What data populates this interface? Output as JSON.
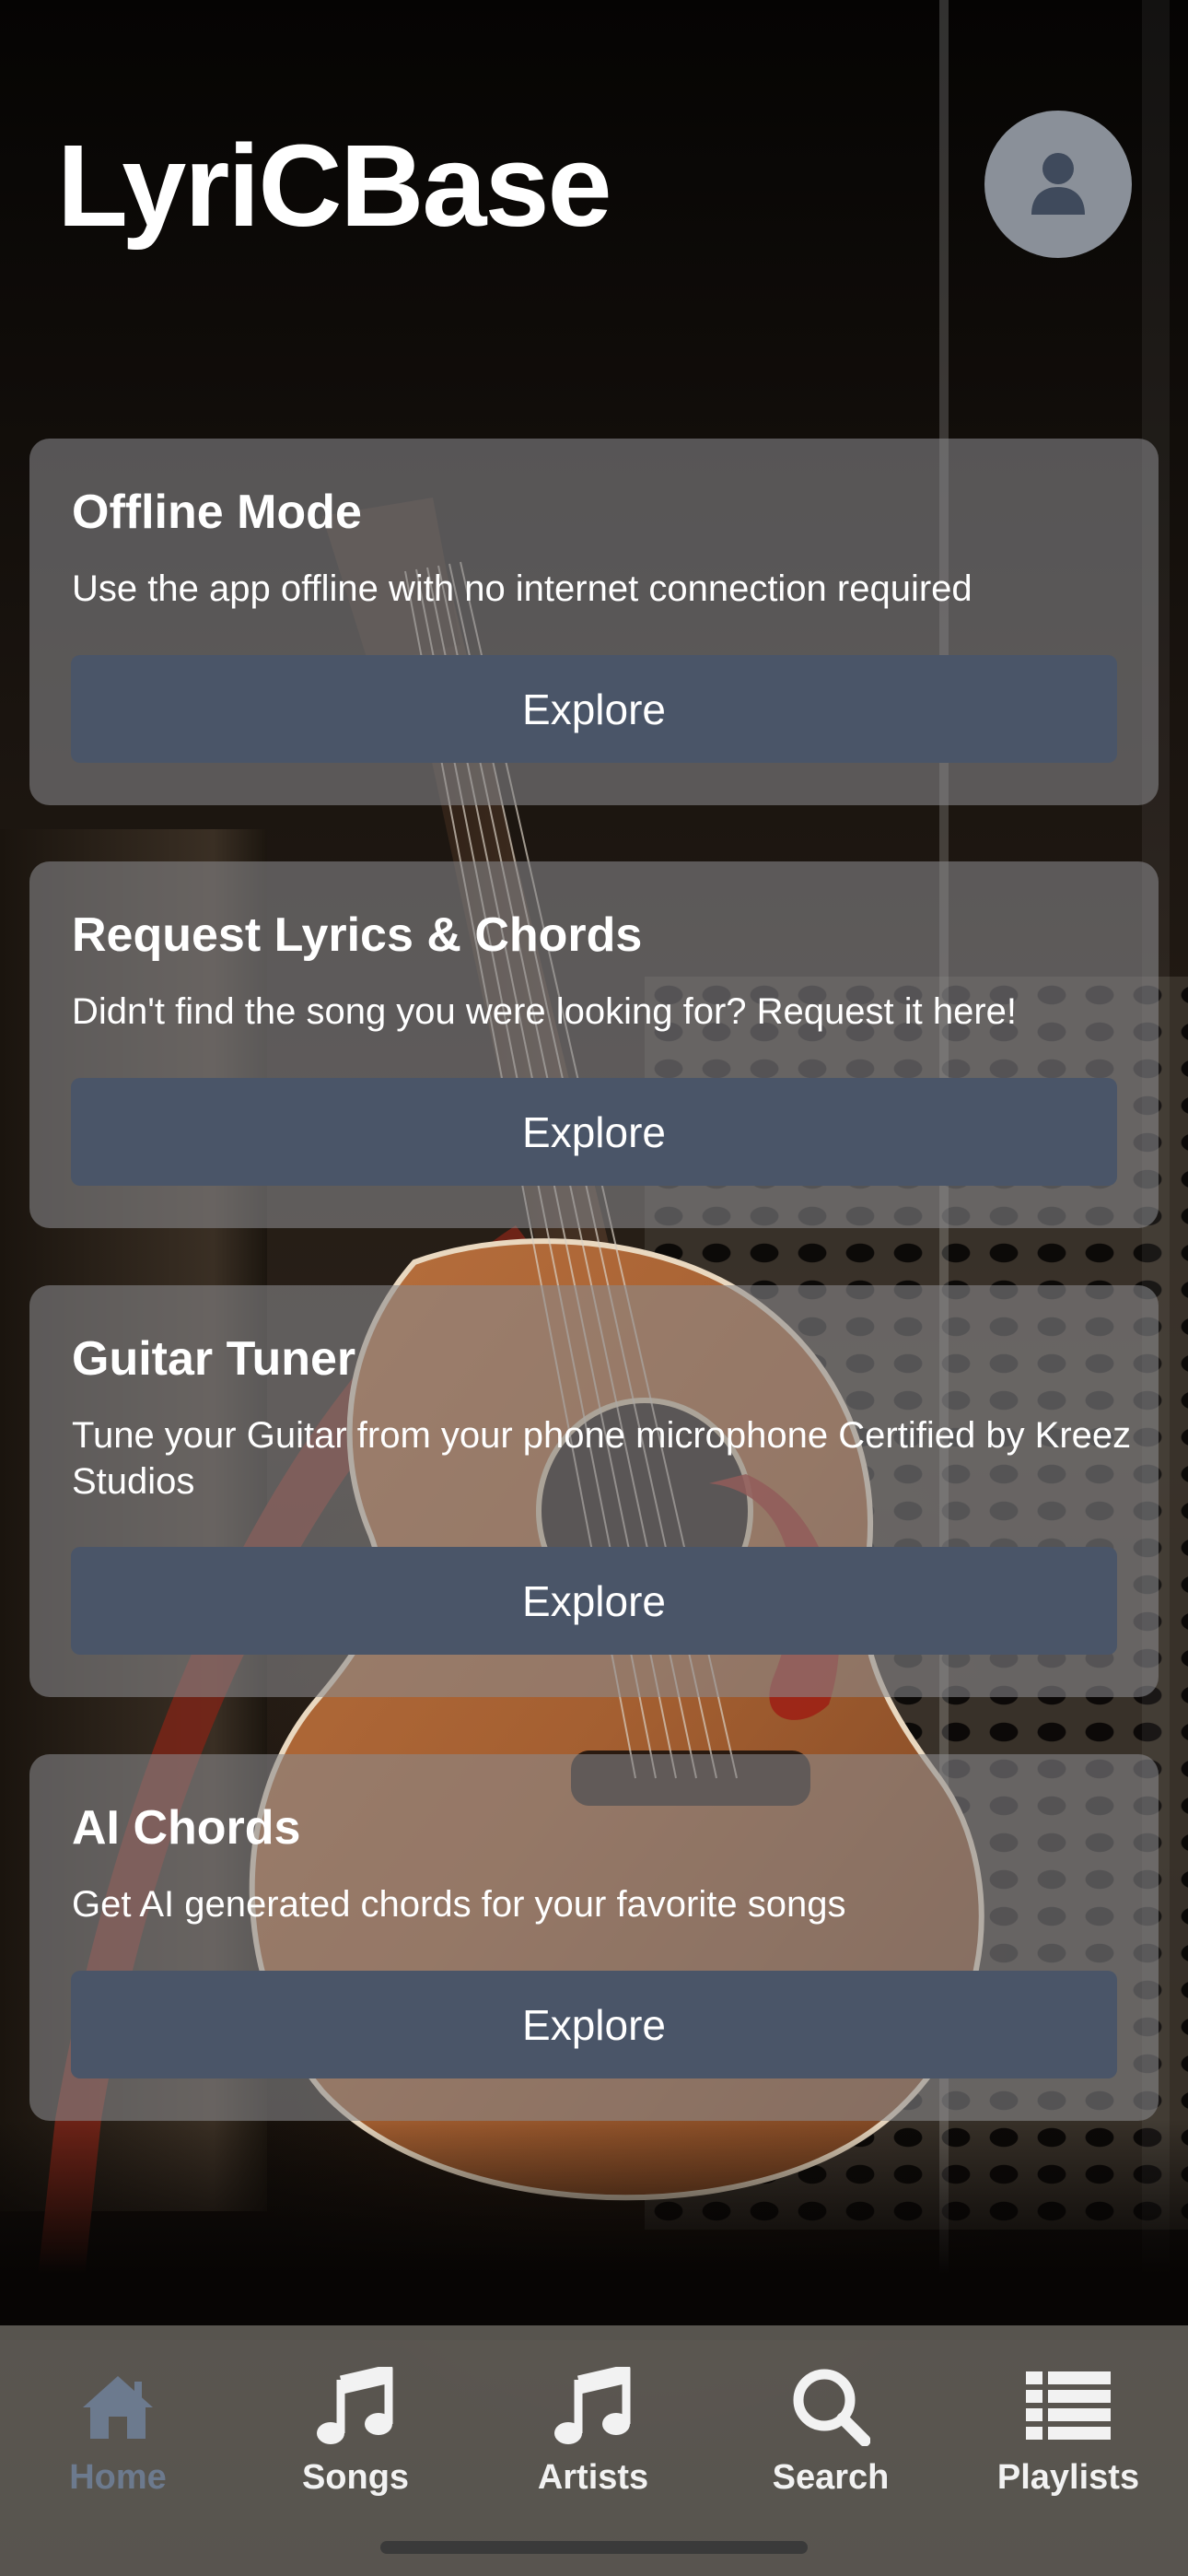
{
  "header": {
    "app_title": "LyriCBase",
    "profile_icon": "person-icon"
  },
  "cards": [
    {
      "title": "Offline Mode",
      "description": "Use the app offline with no internet connection required",
      "button_label": "Explore"
    },
    {
      "title": "Request Lyrics & Chords",
      "description": "Didn't find the song you were looking for? Request it here!",
      "button_label": "Explore"
    },
    {
      "title": "Guitar Tuner",
      "description": "Tune your Guitar from your phone microphone Certified by Kreez Studios",
      "button_label": "Explore"
    },
    {
      "title": "AI Chords",
      "description": "Get AI generated chords for your favorite songs",
      "button_label": "Explore"
    }
  ],
  "tabbar": {
    "active": "Home",
    "items": [
      {
        "label": "Home",
        "icon": "house-icon"
      },
      {
        "label": "Songs",
        "icon": "music-note-icon"
      },
      {
        "label": "Artists",
        "icon": "music-note-icon"
      },
      {
        "label": "Search",
        "icon": "search-icon"
      },
      {
        "label": "Playlists",
        "icon": "list-icon"
      }
    ]
  },
  "colors": {
    "card_background": "#8a8a8e",
    "button_background": "#4a5568",
    "profile_button": "#8a9099",
    "profile_icon": "#3f4a5c",
    "active_tab": "#6c7a8e",
    "inactive_tab": "#f2f2f2"
  }
}
